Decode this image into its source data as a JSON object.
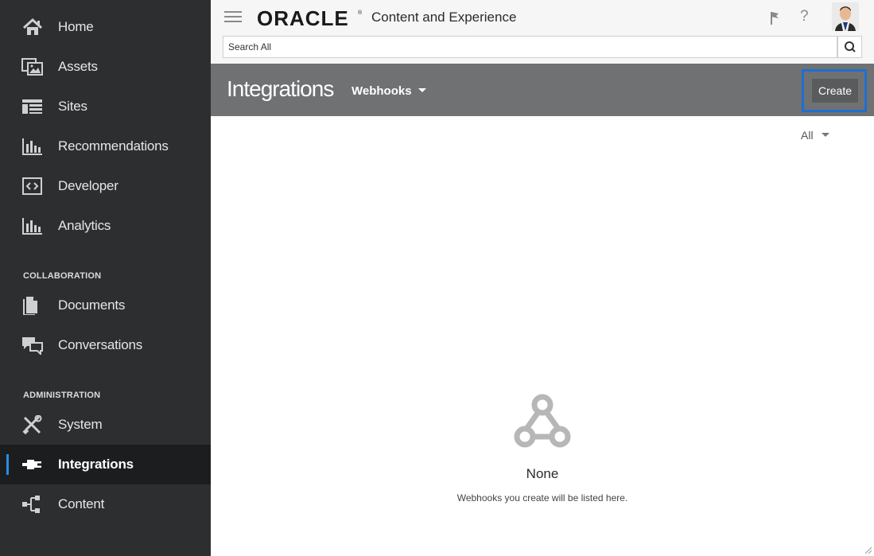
{
  "sidebar": {
    "items": [
      {
        "label": "Home",
        "icon": "home-icon"
      },
      {
        "label": "Assets",
        "icon": "assets-icon"
      },
      {
        "label": "Sites",
        "icon": "sites-icon"
      },
      {
        "label": "Recommendations",
        "icon": "bar-chart-icon"
      },
      {
        "label": "Developer",
        "icon": "code-icon"
      },
      {
        "label": "Analytics",
        "icon": "bar-chart-icon"
      }
    ],
    "collaboration_heading": "COLLABORATION",
    "collaboration_items": [
      {
        "label": "Documents",
        "icon": "documents-icon"
      },
      {
        "label": "Conversations",
        "icon": "conversations-icon"
      }
    ],
    "administration_heading": "ADMINISTRATION",
    "administration_items": [
      {
        "label": "System",
        "icon": "tools-icon"
      },
      {
        "label": "Integrations",
        "icon": "plug-icon",
        "active": true
      },
      {
        "label": "Content",
        "icon": "hierarchy-icon"
      }
    ]
  },
  "topbar": {
    "brand": "ORACLE",
    "product": "Content and Experience",
    "search_placeholder": "Search All"
  },
  "header": {
    "title": "Integrations",
    "dropdown": "Webhooks",
    "create_label": "Create"
  },
  "main": {
    "filter": "All",
    "empty_title": "None",
    "empty_desc": "Webhooks you create will be listed here."
  },
  "colors": {
    "sidebar_bg": "#2d2e30",
    "active_bg": "#1c1d1e",
    "active_marker": "#2b8ce0",
    "header_bg": "#6f7173",
    "highlight": "#1f6fd0"
  }
}
